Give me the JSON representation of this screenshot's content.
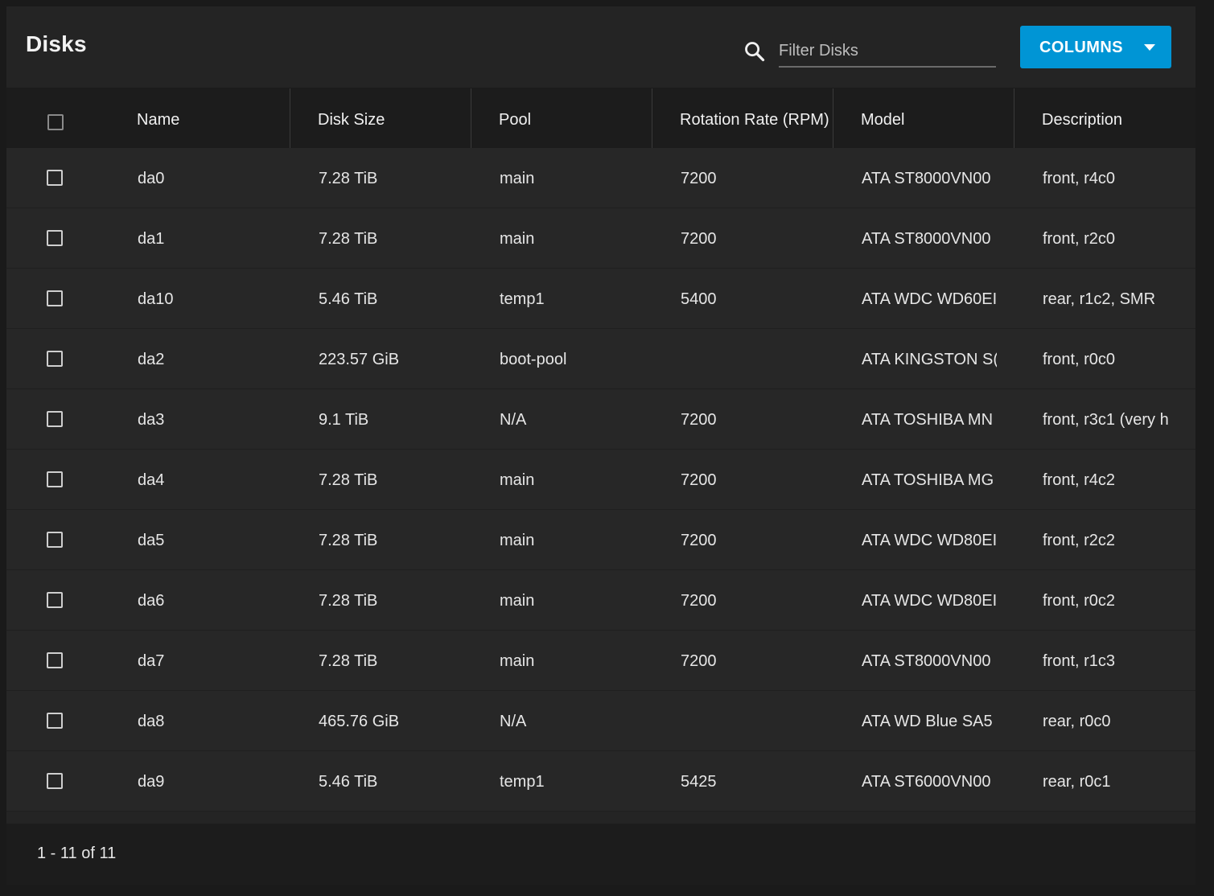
{
  "header": {
    "title": "Disks",
    "filter_placeholder": "Filter Disks",
    "columns_button": "COLUMNS"
  },
  "table": {
    "columns": [
      "Name",
      "Disk Size",
      "Pool",
      "Rotation Rate (RPM)",
      "Model",
      "Description"
    ],
    "rows": [
      {
        "name": "da0",
        "size": "7.28 TiB",
        "pool": "main",
        "rpm": "7200",
        "model": "ATA ST8000VN00",
        "description": "front, r4c0"
      },
      {
        "name": "da1",
        "size": "7.28 TiB",
        "pool": "main",
        "rpm": "7200",
        "model": "ATA ST8000VN00",
        "description": "front, r2c0"
      },
      {
        "name": "da10",
        "size": "5.46 TiB",
        "pool": "temp1",
        "rpm": "5400",
        "model": "ATA WDC WD60EI",
        "description": "rear, r1c2, SMR"
      },
      {
        "name": "da2",
        "size": "223.57 GiB",
        "pool": "boot-pool",
        "rpm": "",
        "model": "ATA KINGSTON S(",
        "description": "front, r0c0"
      },
      {
        "name": "da3",
        "size": "9.1 TiB",
        "pool": "N/A",
        "rpm": "7200",
        "model": "ATA TOSHIBA MN",
        "description": "front, r3c1 (very h"
      },
      {
        "name": "da4",
        "size": "7.28 TiB",
        "pool": "main",
        "rpm": "7200",
        "model": "ATA TOSHIBA MG",
        "description": "front, r4c2"
      },
      {
        "name": "da5",
        "size": "7.28 TiB",
        "pool": "main",
        "rpm": "7200",
        "model": "ATA WDC WD80EI",
        "description": "front, r2c2"
      },
      {
        "name": "da6",
        "size": "7.28 TiB",
        "pool": "main",
        "rpm": "7200",
        "model": "ATA WDC WD80EI",
        "description": "front, r0c2"
      },
      {
        "name": "da7",
        "size": "7.28 TiB",
        "pool": "main",
        "rpm": "7200",
        "model": "ATA ST8000VN00",
        "description": "front, r1c3"
      },
      {
        "name": "da8",
        "size": "465.76 GiB",
        "pool": "N/A",
        "rpm": "",
        "model": "ATA WD Blue SA5",
        "description": "rear, r0c0"
      },
      {
        "name": "da9",
        "size": "5.46 TiB",
        "pool": "temp1",
        "rpm": "5425",
        "model": "ATA ST6000VN00",
        "description": "rear, r0c1"
      }
    ]
  },
  "footer": {
    "range": "1 - 11 of 11"
  },
  "colors": {
    "accent": "#0095d5",
    "background": "#242424"
  }
}
